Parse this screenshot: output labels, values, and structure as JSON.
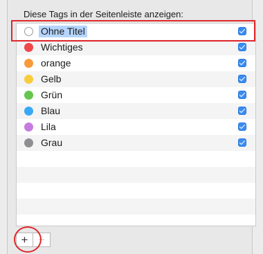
{
  "heading": "Diese Tags in der Seitenleiste anzeigen:",
  "tags": [
    {
      "label": "Ohne Titel",
      "color": null,
      "checked": true,
      "selected": true
    },
    {
      "label": "Wichtiges",
      "color": "#f0474a",
      "checked": true
    },
    {
      "label": "orange",
      "color": "#f89a3a",
      "checked": true
    },
    {
      "label": "Gelb",
      "color": "#f9cc3c",
      "checked": true
    },
    {
      "label": "Grün",
      "color": "#65c54e",
      "checked": true
    },
    {
      "label": "Blau",
      "color": "#3aa9f5",
      "checked": true
    },
    {
      "label": "Lila",
      "color": "#c77be0",
      "checked": true
    },
    {
      "label": "Grau",
      "color": "#8e8e93",
      "checked": true
    }
  ],
  "buttons": {
    "add_label": "+",
    "remove_label": "−"
  },
  "colors": {
    "checkbox": "#3a8cf2",
    "selection": "#b5d5fd",
    "annotation": "#e0262b"
  }
}
